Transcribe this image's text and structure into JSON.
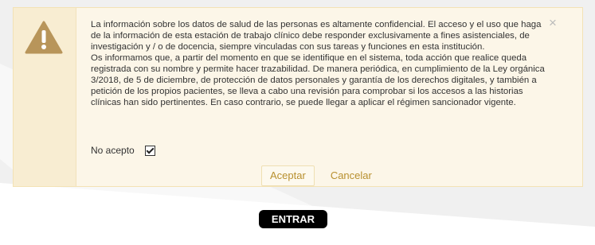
{
  "dialog": {
    "paragraph1": "La información sobre los datos de salud de las personas es altamente confidencial. El acceso y el uso que haga de la información de esta estación de trabajo clínico debe responder exclusivamente a fines asistenciales, de investigación y / o de docencia, siempre vinculadas con sus tareas y funciones en esta institución.",
    "paragraph2": "Os informamos que, a partir del momento en que se identifique en el sistema, toda acción que realice queda registrada con su nombre y permite hacer trazabilidad. De manera periódica, en cumplimiento de la Ley orgánica 3/2018, de 5 de diciembre, de protección de datos personales y garantía de los derechos digitales, y también a petición de los propios pacientes, se lleva a cabo una revisión para comprobar si los accesos a las historias clínicas han sido pertinentes. En caso contrario, se puede llegar a aplicar el régimen sancionador vigente.",
    "close_symbol": "×",
    "consent_label": "No acepto",
    "consent_checked": true,
    "accept_label": "Aceptar",
    "cancel_label": "Cancelar",
    "icon": "warning-icon"
  },
  "enter_button_label": "ENTRAR",
  "colors": {
    "dialog_bg": "#fcf6e8",
    "icon_bg": "#f8edd2",
    "accent": "#b8902f",
    "warning_icon": "#b8955a"
  }
}
